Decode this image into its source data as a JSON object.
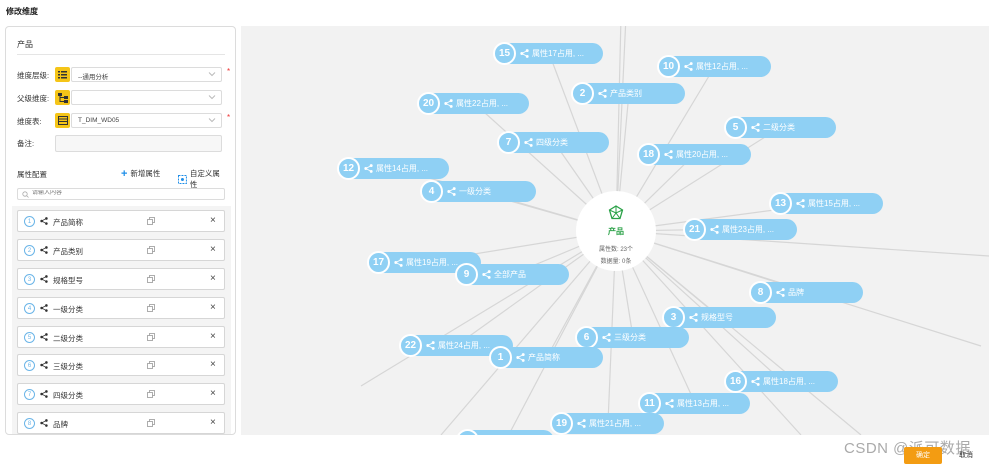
{
  "page": {
    "title": "修改维度"
  },
  "panel": {
    "title": "产品",
    "fields": {
      "level": {
        "label": "维度层级:",
        "value": "--通用分析",
        "icon": "list-icon",
        "required": "*"
      },
      "parent": {
        "label": "父级维度:",
        "value": "",
        "icon": "tree-icon"
      },
      "table": {
        "label": "维度表:",
        "value": "T_DIM_WD05",
        "icon": "table-icon",
        "required": "*"
      },
      "remark": {
        "label": "备注:",
        "value": ""
      }
    },
    "attr_config": {
      "title": "属性配置",
      "add_label": "新增属性",
      "custom_label": "自定义属性",
      "search_placeholder": "请输入内容"
    },
    "attrs": [
      {
        "num": "1",
        "name": "产品简称"
      },
      {
        "num": "2",
        "name": "产品类别"
      },
      {
        "num": "3",
        "name": "规格型号"
      },
      {
        "num": "4",
        "name": "一级分类"
      },
      {
        "num": "5",
        "name": "二级分类"
      },
      {
        "num": "6",
        "name": "三级分类"
      },
      {
        "num": "7",
        "name": "四级分类"
      },
      {
        "num": "8",
        "name": "品牌"
      }
    ]
  },
  "graph": {
    "center": {
      "title": "产品",
      "count_text": "属性数: 23个",
      "data_text": "数据量: 0条"
    },
    "nodes": [
      {
        "num": "15",
        "label": "属性17占用, ..."
      },
      {
        "num": "10",
        "label": "属性12占用, ..."
      },
      {
        "num": "2",
        "label": "产品类别"
      },
      {
        "num": "20",
        "label": "属性22占用, ..."
      },
      {
        "num": "5",
        "label": "二级分类"
      },
      {
        "num": "7",
        "label": "四级分类"
      },
      {
        "num": "18",
        "label": "属性20占用, ..."
      },
      {
        "num": "12",
        "label": "属性14占用, ..."
      },
      {
        "num": "4",
        "label": "一级分类"
      },
      {
        "num": "13",
        "label": "属性15占用, ..."
      },
      {
        "num": "21",
        "label": "属性23占用, ..."
      },
      {
        "num": "17",
        "label": "属性19占用, ..."
      },
      {
        "num": "9",
        "label": "全部产品"
      },
      {
        "num": "8",
        "label": "品牌"
      },
      {
        "num": "3",
        "label": "规格型号"
      },
      {
        "num": "6",
        "label": "三级分类"
      },
      {
        "num": "22",
        "label": "属性24占用, ..."
      },
      {
        "num": "1",
        "label": "产品简称"
      },
      {
        "num": "16",
        "label": "属性18占用, ..."
      },
      {
        "num": "11",
        "label": "属性13占用, ..."
      },
      {
        "num": "19",
        "label": "属性21占用, ..."
      },
      {
        "num": "",
        "label": ""
      }
    ]
  },
  "footer": {
    "watermark": "CSDN @派可数据",
    "confirm_label": "确定",
    "cancel_label": "取消"
  },
  "colors": {
    "accent": "#1e8ee8",
    "node": "#8fd0f4",
    "icon_bg": "#f5c518",
    "center_title": "#2aa147",
    "confirm": "#f39c12"
  }
}
